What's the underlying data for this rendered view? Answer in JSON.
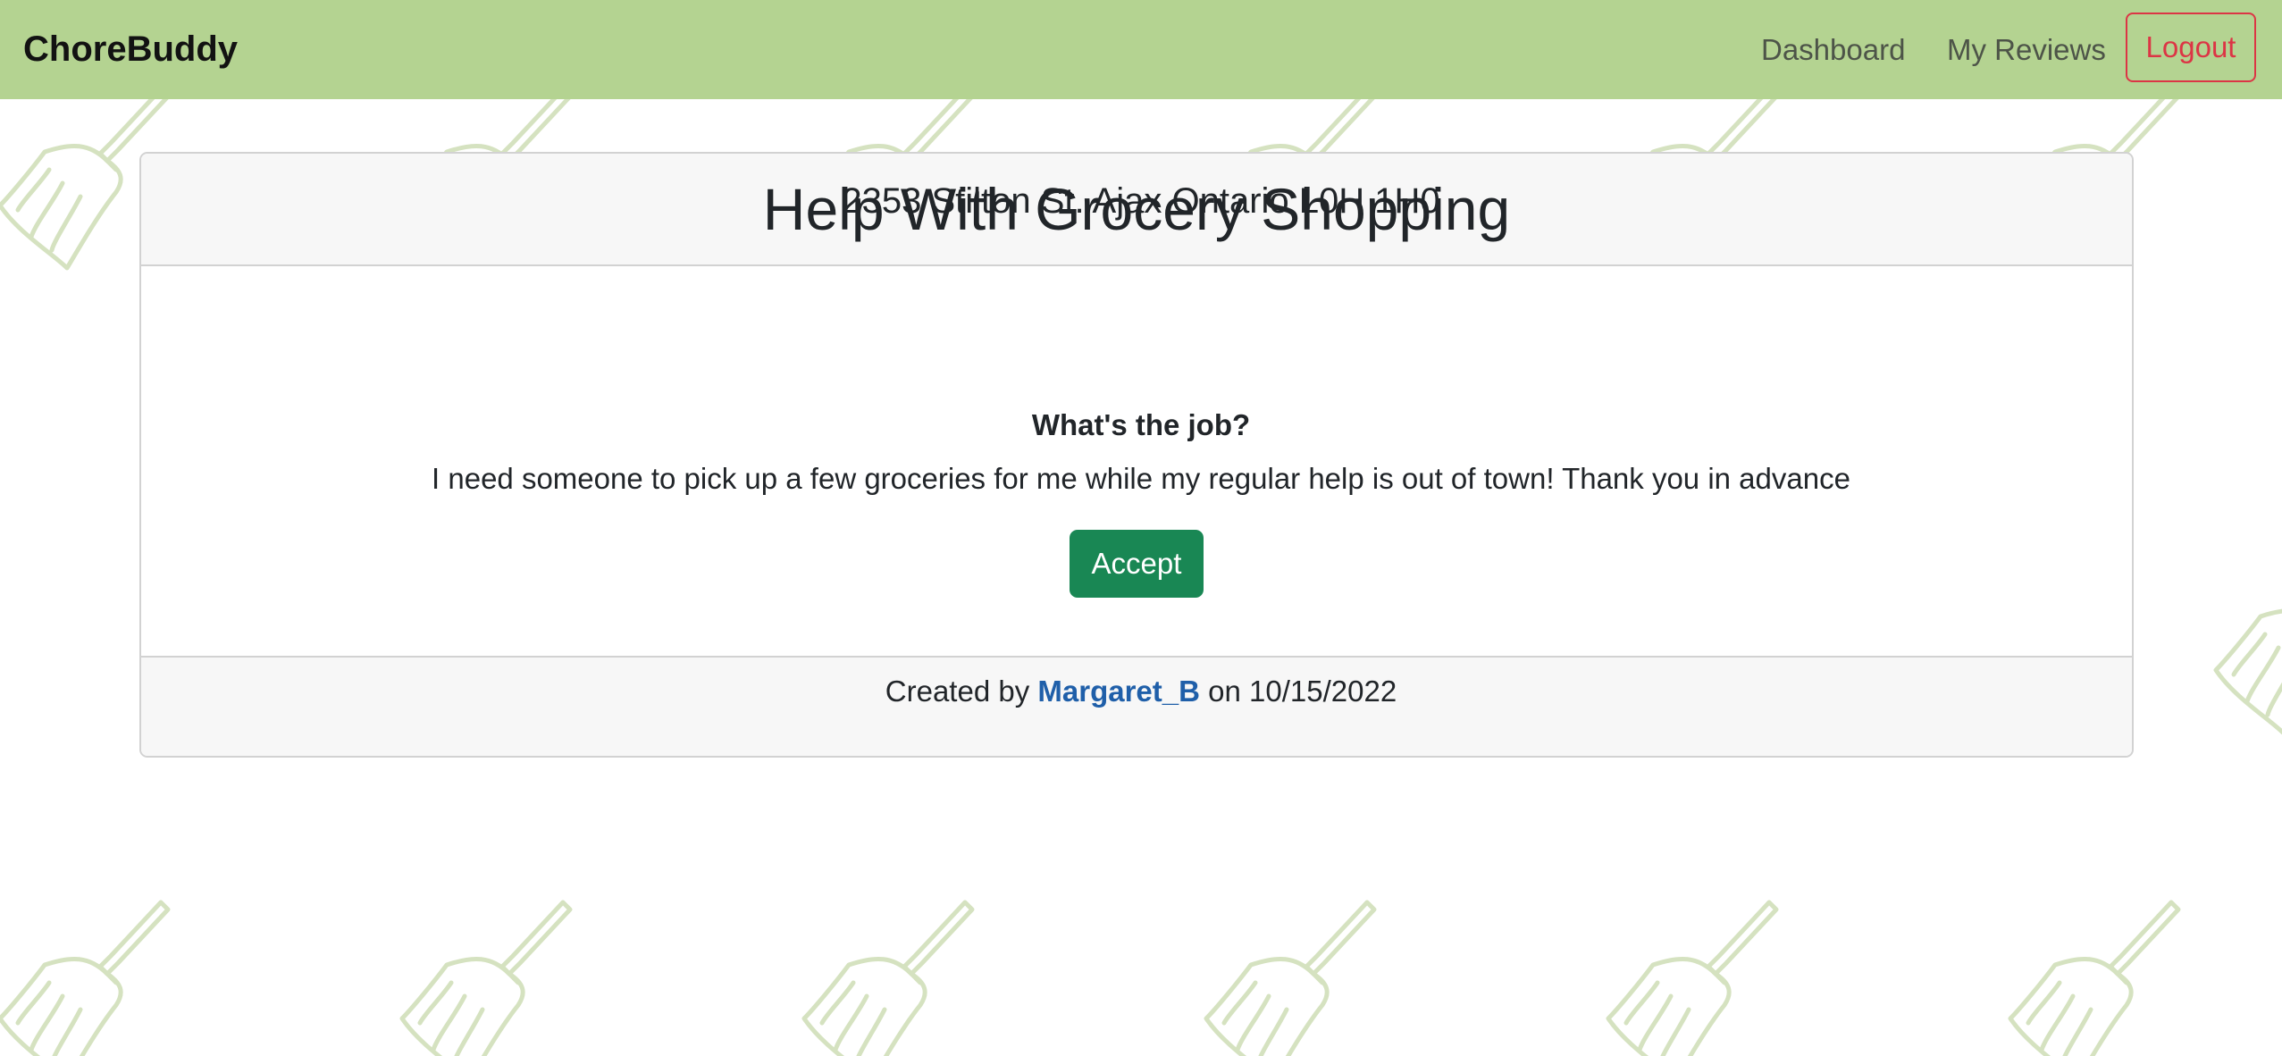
{
  "navbar": {
    "brand": "ChoreBuddy",
    "links": [
      {
        "label": "Dashboard"
      },
      {
        "label": "My Reviews"
      }
    ],
    "logout_label": "Logout"
  },
  "job": {
    "title": "Help With Grocery Shopping",
    "address": "2353 Stilton St. Ajax Ontario L0H 1H0",
    "question": "What's the job?",
    "description": "I need someone to pick up a few groceries for me while my regular help is out of town! Thank you in advance",
    "accept_label": "Accept"
  },
  "footer": {
    "created_prefix": "Created by",
    "author": "Margaret_B",
    "date_prefix": "on",
    "date": "10/15/2022"
  },
  "colors": {
    "navbar_bg": "#b4d391",
    "accept_green": "#198754",
    "logout_red": "#dc3545",
    "link_blue": "#1f5fa9",
    "broom_pattern": "#d5e2c0"
  },
  "icons": {
    "background": "broom-icon"
  }
}
